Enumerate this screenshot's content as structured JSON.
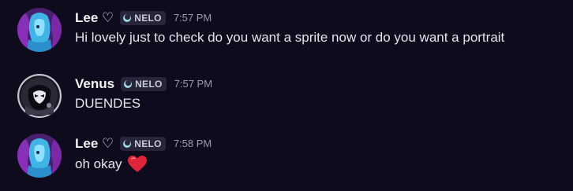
{
  "messages": [
    {
      "username": "Lee ♡",
      "tag": "NELO",
      "time": "7:57 PM",
      "text": "Hi lovely just to check do you want a sprite now or do you want a portrait",
      "avatar_icon": "blue-character-avatar"
    },
    {
      "username": "Venus",
      "tag": "NELO",
      "time": "7:57 PM",
      "text": "DUENDES",
      "avatar_icon": "dark-character-avatar"
    },
    {
      "username": "Lee ♡",
      "tag": "NELO",
      "time": "7:58 PM",
      "text": "oh okay",
      "emoji": "red-heart-emoji",
      "avatar_icon": "blue-character-avatar"
    }
  ],
  "colors": {
    "background": "#0e0c1c",
    "username": "#f2f3f5",
    "text": "#e4e5ea",
    "timestamp": "#9a9ca6",
    "tag_bg": "#26253a",
    "tag_icon": "#9fd9e8",
    "heart": "#e0243a"
  }
}
